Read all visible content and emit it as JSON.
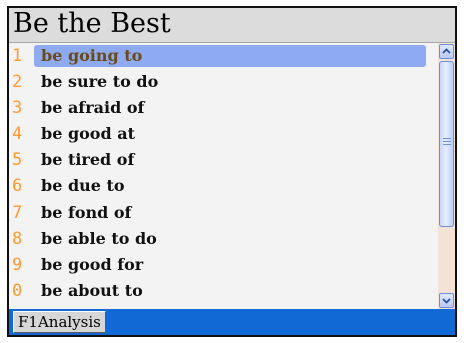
{
  "window": {
    "title": "Be the Best"
  },
  "list": {
    "items": [
      {
        "number": "1",
        "phrase": "be going to",
        "selected": true
      },
      {
        "number": "2",
        "phrase": "be sure to do",
        "selected": false
      },
      {
        "number": "3",
        "phrase": "be afraid of",
        "selected": false
      },
      {
        "number": "4",
        "phrase": "be good at",
        "selected": false
      },
      {
        "number": "5",
        "phrase": "be tired of",
        "selected": false
      },
      {
        "number": "6",
        "phrase": "be due to",
        "selected": false
      },
      {
        "number": "7",
        "phrase": "be fond of",
        "selected": false
      },
      {
        "number": "8",
        "phrase": "be able to do",
        "selected": false
      },
      {
        "number": "9",
        "phrase": "be good for",
        "selected": false
      },
      {
        "number": "0",
        "phrase": "be about to",
        "selected": false
      }
    ]
  },
  "scrollbar": {
    "up_icon": "scroll-up-arrow-icon",
    "down_icon": "scroll-down-arrow-icon"
  },
  "toolbar": {
    "analysis_label": "F1Analysis"
  },
  "colors": {
    "number": "#ff9a2e",
    "selection": "#8eaaf0",
    "selected_text": "#6b4a1a",
    "bottom_bar": "#1169d6",
    "scroll_track": "#f2e3d6"
  }
}
